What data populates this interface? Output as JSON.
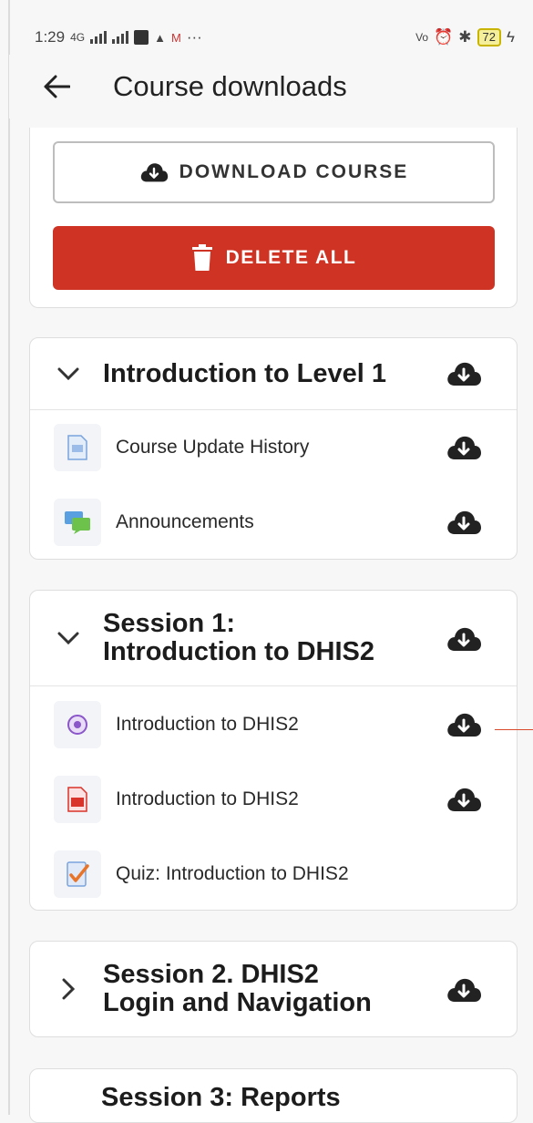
{
  "status_bar": {
    "time": "1:29",
    "network_small": "4G",
    "battery": "72"
  },
  "header": {
    "title": "Course downloads"
  },
  "actions": {
    "download_course": "DOWNLOAD COURSE",
    "delete_all": "DELETE ALL"
  },
  "sections": [
    {
      "title": "Introduction to Level 1",
      "items": [
        {
          "label": "Course Update History"
        },
        {
          "label": "Announcements"
        }
      ]
    },
    {
      "title_line1": "Session 1:",
      "title_line2": "Introduction to DHIS2",
      "items": [
        {
          "label": "Introduction to DHIS2"
        },
        {
          "label": "Introduction to DHIS2"
        },
        {
          "label": "Quiz: Introduction to DHIS2"
        }
      ]
    },
    {
      "title_line1": "Session 2. DHIS2",
      "title_line2": "Login and Navigation"
    },
    {
      "title": "Session 3: Reports"
    }
  ],
  "colors": {
    "delete": "#cf3323",
    "accent_line": "#d84a2b"
  }
}
